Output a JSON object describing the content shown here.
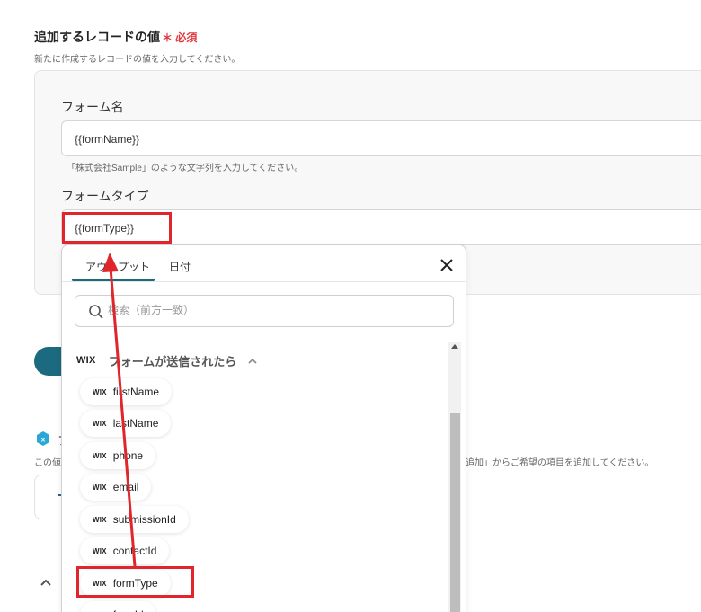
{
  "section": {
    "title": "追加するレコードの値",
    "required_mark": "＊ 必須",
    "description": "新たに作成するレコードの値を入力してください。"
  },
  "fields": {
    "form_name": {
      "label": "フォーム名",
      "value": "{{formName}}",
      "help": "「株式会社Sample」のような文字列を入力してください。"
    },
    "form_type": {
      "label": "フォームタイプ",
      "value": "{{formType}}"
    }
  },
  "background": {
    "partial_title": "フ",
    "desc_left": "この値",
    "desc_right": "追加」からご希望の項目を追加してください。",
    "dash": "-"
  },
  "popover": {
    "tabs": [
      "アウトプット",
      "日付"
    ],
    "close_icon": "close-icon",
    "search_placeholder": "検索（前方一致）",
    "group": {
      "logo": "WIX",
      "title": "フォームが送信されたら",
      "chevron": "chevron-up-icon"
    },
    "chip_logo": "WIX",
    "outputs": [
      "firstName",
      "lastName",
      "phone",
      "email",
      "submissionId",
      "contactId",
      "formType",
      "formId"
    ]
  },
  "colors": {
    "accent": "#1b6a80",
    "required": "#e0383e",
    "annotation": "#e0262c"
  }
}
